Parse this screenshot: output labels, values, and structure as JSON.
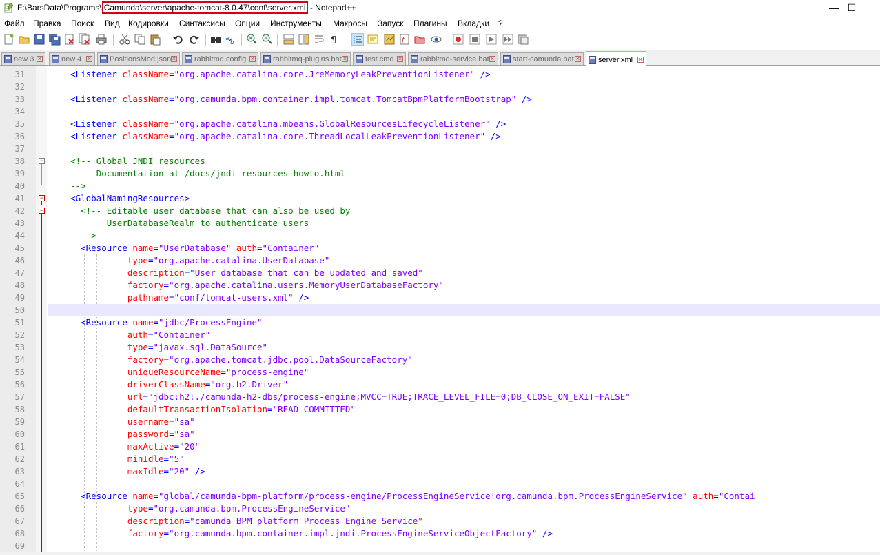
{
  "window": {
    "title_prefix": "F:\\BarsData\\Programs\\",
    "title_highlight": "Camunda\\server\\apache-tomcat-8.0.47\\conf\\server.xml",
    "title_suffix": " - Notepad++",
    "minimize_glyph": "—",
    "maximize_glyph": "☐"
  },
  "menu": [
    "Файл",
    "Правка",
    "Поиск",
    "Вид",
    "Кодировки",
    "Синтаксисы",
    "Опции",
    "Инструменты",
    "Макросы",
    "Запуск",
    "Плагины",
    "Вкладки",
    "?"
  ],
  "toolbar": {
    "buttons": [
      "new-file-icon",
      "open-file-icon",
      "save-icon",
      "save-all-icon",
      "close-icon",
      "close-all-icon",
      "print-icon",
      "cut-icon",
      "copy-icon",
      "paste-icon",
      "undo-icon",
      "redo-icon",
      "find-icon",
      "replace-icon",
      "zoom-in-icon",
      "zoom-out-icon",
      "sync-vertical-icon",
      "sync-horizontal-icon",
      "word-wrap-icon",
      "show-all-chars-icon",
      "indent-guide-icon",
      "udl-icon",
      "doc-map-icon",
      "function-list-icon",
      "folder-workspace-icon",
      "monitoring-icon",
      "record-macro-icon",
      "stop-macro-icon",
      "play-macro-icon",
      "run-macro-multiple-icon",
      "save-macro-icon"
    ]
  },
  "tabs": [
    {
      "label": "new 3",
      "active": false
    },
    {
      "label": "new 4",
      "active": false
    },
    {
      "label": "PositionsMod.json",
      "active": false
    },
    {
      "label": "rabbitmq.config",
      "active": false
    },
    {
      "label": "rabbitmq-plugins.bat",
      "active": false
    },
    {
      "label": "test.cmd",
      "active": false
    },
    {
      "label": "rabbitmq-service.bat",
      "active": false
    },
    {
      "label": "start-camunda.bat",
      "active": false
    },
    {
      "label": "server.xml",
      "active": true
    }
  ],
  "editor": {
    "current_line": 50,
    "lines": [
      {
        "n": "31",
        "indent": "  ",
        "parts": [
          [
            "t",
            "<Listener "
          ],
          [
            "a",
            "className"
          ],
          [
            "t",
            "="
          ],
          [
            "v",
            "\"org.apache.catalina.core.JreMemoryLeakPreventionListener\""
          ],
          [
            "t",
            " />"
          ]
        ]
      },
      {
        "n": "32",
        "indent": "",
        "parts": []
      },
      {
        "n": "33",
        "indent": "  ",
        "parts": [
          [
            "t",
            "<Listener "
          ],
          [
            "a",
            "className"
          ],
          [
            "t",
            "="
          ],
          [
            "v",
            "\"org.camunda.bpm.container.impl.tomcat.TomcatBpmPlatformBootstrap\""
          ],
          [
            "t",
            " />"
          ]
        ]
      },
      {
        "n": "34",
        "indent": "",
        "parts": []
      },
      {
        "n": "35",
        "indent": "  ",
        "parts": [
          [
            "t",
            "<Listener "
          ],
          [
            "a",
            "className"
          ],
          [
            "t",
            "="
          ],
          [
            "v",
            "\"org.apache.catalina.mbeans.GlobalResourcesLifecycleListener\""
          ],
          [
            "t",
            " />"
          ]
        ]
      },
      {
        "n": "36",
        "indent": "  ",
        "parts": [
          [
            "t",
            "<Listener "
          ],
          [
            "a",
            "className"
          ],
          [
            "t",
            "="
          ],
          [
            "v",
            "\"org.apache.catalina.core.ThreadLocalLeakPreventionListener\""
          ],
          [
            "t",
            " />"
          ]
        ]
      },
      {
        "n": "37",
        "indent": "",
        "parts": []
      },
      {
        "n": "38",
        "indent": "  ",
        "parts": [
          [
            "c",
            "<!-- Global JNDI resources"
          ]
        ]
      },
      {
        "n": "39",
        "indent": "  ",
        "parts": [
          [
            "c",
            "     Documentation at /docs/jndi-resources-howto.html"
          ]
        ]
      },
      {
        "n": "40",
        "indent": "  ",
        "parts": [
          [
            "c",
            "-->"
          ]
        ]
      },
      {
        "n": "41",
        "indent": "  ",
        "parts": [
          [
            "t",
            "<GlobalNamingResources>"
          ]
        ]
      },
      {
        "n": "42",
        "indent": "    ",
        "parts": [
          [
            "c",
            "<!-- Editable user database that can also be used by"
          ]
        ]
      },
      {
        "n": "43",
        "indent": "    ",
        "parts": [
          [
            "c",
            "     UserDatabaseRealm to authenticate users"
          ]
        ]
      },
      {
        "n": "44",
        "indent": "    ",
        "parts": [
          [
            "c",
            "-->"
          ]
        ]
      },
      {
        "n": "45",
        "indent": "    ",
        "parts": [
          [
            "t",
            "<Resource "
          ],
          [
            "a",
            "name"
          ],
          [
            "t",
            "="
          ],
          [
            "v",
            "\"UserDatabase\""
          ],
          [
            "t",
            " "
          ],
          [
            "a",
            "auth"
          ],
          [
            "t",
            "="
          ],
          [
            "v",
            "\"Container\""
          ]
        ]
      },
      {
        "n": "46",
        "indent": "             ",
        "parts": [
          [
            "a",
            "type"
          ],
          [
            "t",
            "="
          ],
          [
            "v",
            "\"org.apache.catalina.UserDatabase\""
          ]
        ]
      },
      {
        "n": "47",
        "indent": "             ",
        "parts": [
          [
            "a",
            "description"
          ],
          [
            "t",
            "="
          ],
          [
            "v",
            "\"User database that can be updated and saved\""
          ]
        ]
      },
      {
        "n": "48",
        "indent": "             ",
        "parts": [
          [
            "a",
            "factory"
          ],
          [
            "t",
            "="
          ],
          [
            "v",
            "\"org.apache.catalina.users.MemoryUserDatabaseFactory\""
          ]
        ]
      },
      {
        "n": "49",
        "indent": "             ",
        "parts": [
          [
            "a",
            "pathname"
          ],
          [
            "t",
            "="
          ],
          [
            "v",
            "\"conf/tomcat-users.xml\""
          ],
          [
            "t",
            " />"
          ]
        ]
      },
      {
        "n": "50",
        "indent": "",
        "parts": []
      },
      {
        "n": "51",
        "indent": "    ",
        "parts": [
          [
            "t",
            "<Resource "
          ],
          [
            "a",
            "name"
          ],
          [
            "t",
            "="
          ],
          [
            "v",
            "\"jdbc/ProcessEngine\""
          ]
        ]
      },
      {
        "n": "52",
        "indent": "             ",
        "parts": [
          [
            "a",
            "auth"
          ],
          [
            "t",
            "="
          ],
          [
            "v",
            "\"Container\""
          ]
        ]
      },
      {
        "n": "53",
        "indent": "             ",
        "parts": [
          [
            "a",
            "type"
          ],
          [
            "t",
            "="
          ],
          [
            "v",
            "\"javax.sql.DataSource\""
          ]
        ]
      },
      {
        "n": "54",
        "indent": "             ",
        "parts": [
          [
            "a",
            "factory"
          ],
          [
            "t",
            "="
          ],
          [
            "v",
            "\"org.apache.tomcat.jdbc.pool.DataSourceFactory\""
          ]
        ]
      },
      {
        "n": "55",
        "indent": "             ",
        "parts": [
          [
            "a",
            "uniqueResourceName"
          ],
          [
            "t",
            "="
          ],
          [
            "v",
            "\"process-engine\""
          ]
        ]
      },
      {
        "n": "56",
        "indent": "             ",
        "parts": [
          [
            "a",
            "driverClassName"
          ],
          [
            "t",
            "="
          ],
          [
            "v",
            "\"org.h2.Driver\""
          ]
        ]
      },
      {
        "n": "57",
        "indent": "             ",
        "parts": [
          [
            "a",
            "url"
          ],
          [
            "t",
            "="
          ],
          [
            "v",
            "\"jdbc:h2:./camunda-h2-dbs/process-engine;MVCC=TRUE;TRACE_LEVEL_FILE=0;DB_CLOSE_ON_EXIT=FALSE\""
          ]
        ]
      },
      {
        "n": "58",
        "indent": "             ",
        "parts": [
          [
            "a",
            "defaultTransactionIsolation"
          ],
          [
            "t",
            "="
          ],
          [
            "v",
            "\"READ_COMMITTED\""
          ]
        ]
      },
      {
        "n": "59",
        "indent": "             ",
        "parts": [
          [
            "a",
            "username"
          ],
          [
            "t",
            "="
          ],
          [
            "v",
            "\"sa\""
          ]
        ]
      },
      {
        "n": "60",
        "indent": "             ",
        "parts": [
          [
            "a",
            "password"
          ],
          [
            "t",
            "="
          ],
          [
            "v",
            "\"sa\""
          ]
        ]
      },
      {
        "n": "61",
        "indent": "             ",
        "parts": [
          [
            "a",
            "maxActive"
          ],
          [
            "t",
            "="
          ],
          [
            "v",
            "\"20\""
          ]
        ]
      },
      {
        "n": "62",
        "indent": "             ",
        "parts": [
          [
            "a",
            "minIdle"
          ],
          [
            "t",
            "="
          ],
          [
            "v",
            "\"5\""
          ]
        ]
      },
      {
        "n": "63",
        "indent": "             ",
        "parts": [
          [
            "a",
            "maxIdle"
          ],
          [
            "t",
            "="
          ],
          [
            "v",
            "\"20\""
          ],
          [
            "t",
            " />"
          ]
        ]
      },
      {
        "n": "64",
        "indent": "",
        "parts": []
      },
      {
        "n": "65",
        "indent": "    ",
        "parts": [
          [
            "t",
            "<Resource "
          ],
          [
            "a",
            "name"
          ],
          [
            "t",
            "="
          ],
          [
            "v",
            "\"global/camunda-bpm-platform/process-engine/ProcessEngineService!org.camunda.bpm.ProcessEngineService\""
          ],
          [
            "t",
            " "
          ],
          [
            "a",
            "auth"
          ],
          [
            "t",
            "="
          ],
          [
            "v",
            "\"Contai"
          ]
        ]
      },
      {
        "n": "66",
        "indent": "             ",
        "parts": [
          [
            "a",
            "type"
          ],
          [
            "t",
            "="
          ],
          [
            "v",
            "\"org.camunda.bpm.ProcessEngineService\""
          ]
        ]
      },
      {
        "n": "67",
        "indent": "             ",
        "parts": [
          [
            "a",
            "description"
          ],
          [
            "t",
            "="
          ],
          [
            "v",
            "\"camunda BPM platform Process Engine Service\""
          ]
        ]
      },
      {
        "n": "68",
        "indent": "             ",
        "parts": [
          [
            "a",
            "factory"
          ],
          [
            "t",
            "="
          ],
          [
            "v",
            "\"org.camunda.bpm.container.impl.jndi.ProcessEngineServiceObjectFactory\""
          ],
          [
            "t",
            " />"
          ]
        ]
      },
      {
        "n": "69",
        "indent": "",
        "parts": []
      }
    ]
  }
}
